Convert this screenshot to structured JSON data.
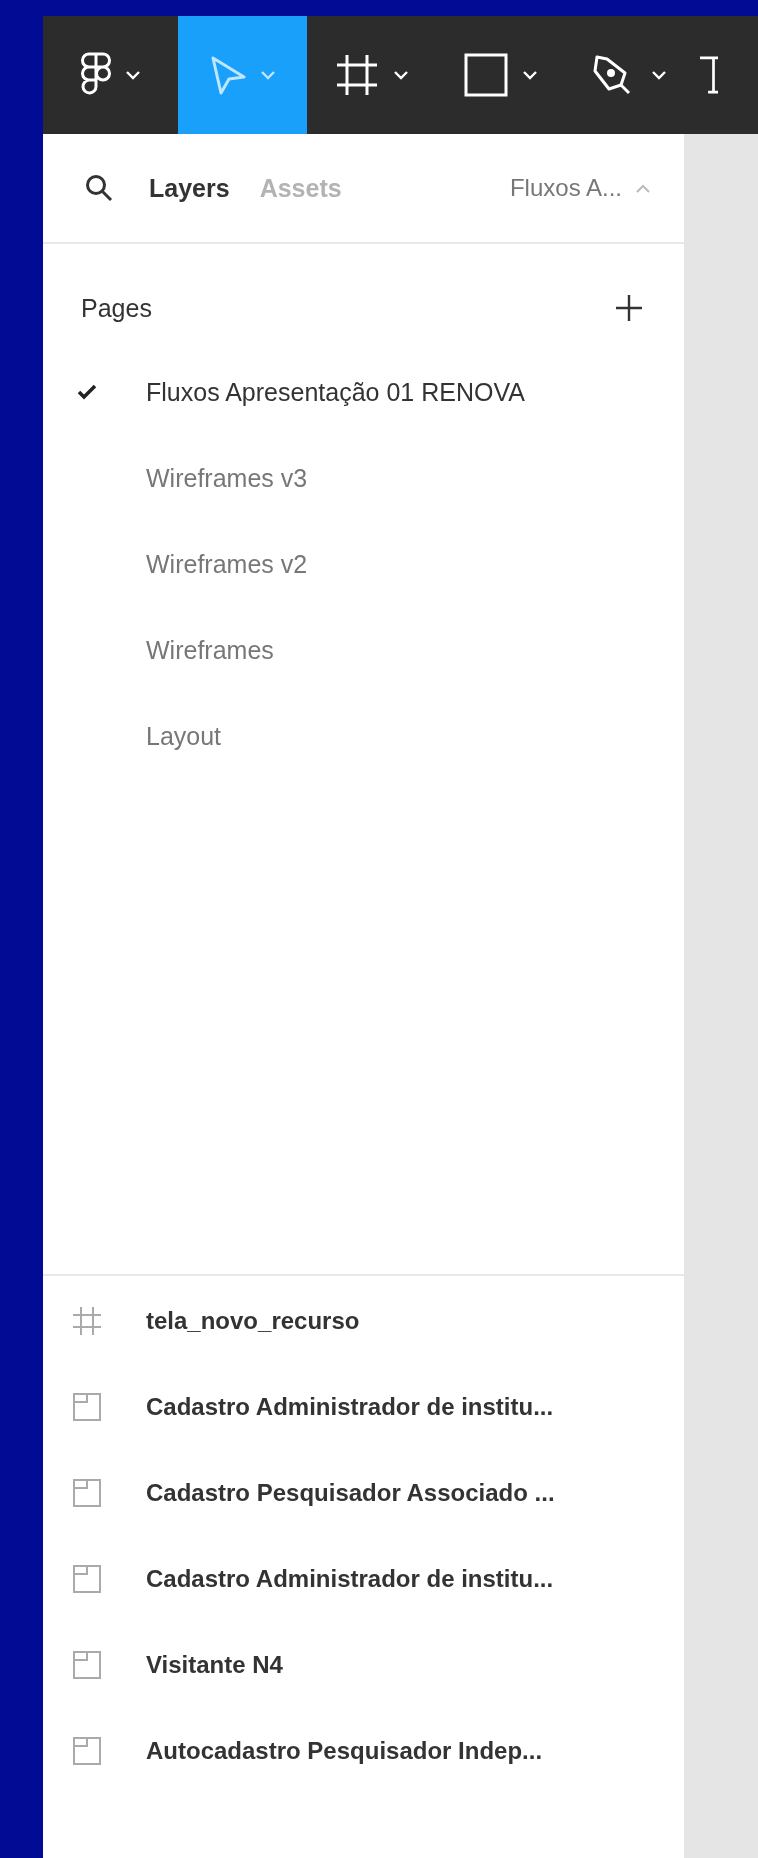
{
  "toolbar": {
    "tools": [
      {
        "kind": "logo",
        "selected": false
      },
      {
        "kind": "move",
        "selected": true
      },
      {
        "kind": "frame",
        "selected": false
      },
      {
        "kind": "shape",
        "selected": false
      },
      {
        "kind": "pen",
        "selected": false
      },
      {
        "kind": "text",
        "selected": false
      }
    ]
  },
  "panel": {
    "tabs": [
      {
        "label": "Layers",
        "selected": true
      },
      {
        "label": "Assets",
        "selected": false
      }
    ],
    "page_menu": {
      "label": "Fluxos A...",
      "expanded": true
    },
    "pages": {
      "heading": "Pages",
      "items": [
        {
          "label": "Fluxos Apresentação 01 RENOVA",
          "selected": true
        },
        {
          "label": "Wireframes v3",
          "selected": false
        },
        {
          "label": "Wireframes v2",
          "selected": false
        },
        {
          "label": "Wireframes",
          "selected": false
        },
        {
          "label": "Layout",
          "selected": false
        }
      ]
    },
    "layers": [
      {
        "kind": "frame",
        "name": "tela_novo_recurso"
      },
      {
        "kind": "section",
        "name": "Cadastro Administrador de institu..."
      },
      {
        "kind": "section",
        "name": "Cadastro Pesquisador Associado ..."
      },
      {
        "kind": "section",
        "name": "Cadastro Administrador de institu..."
      },
      {
        "kind": "section",
        "name": "Visitante N4"
      },
      {
        "kind": "section",
        "name": "Autocadastro Pesquisador Indep..."
      }
    ]
  }
}
